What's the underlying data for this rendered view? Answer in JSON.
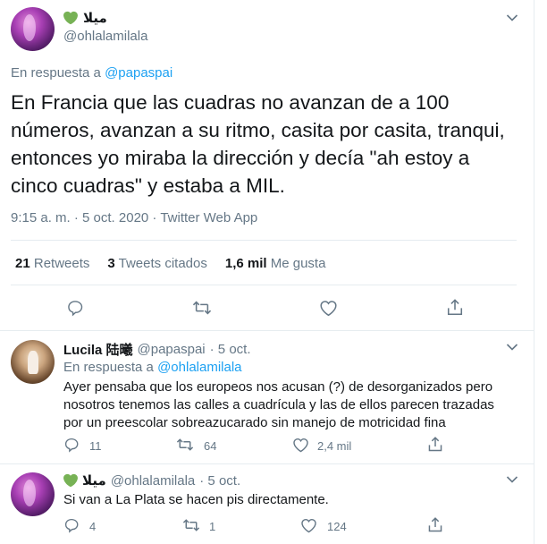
{
  "main_tweet": {
    "author_name": "ميلا",
    "author_handle": "@ohlalamilala",
    "reply_prefix": "En respuesta a",
    "reply_to": "@papaspai",
    "text": "En Francia que las cuadras no avanzan de a 100 números, avanzan a su ritmo, casita por casita, tranqui, entonces yo miraba la dirección y decía \"ah estoy a cinco cuadras\" y estaba a MIL.",
    "meta": "9:15 a. m. · 5 oct. 2020 · Twitter Web App",
    "stats": {
      "retweets_count": "21",
      "retweets_label": "Retweets",
      "quotes_count": "3",
      "quotes_label": "Tweets citados",
      "likes_count": "1,6 mil",
      "likes_label": "Me gusta"
    }
  },
  "replies": [
    {
      "author_name": "Lucila 陆曦",
      "author_handle": "@papaspai",
      "date": "· 5 oct.",
      "reply_prefix": "En respuesta a",
      "reply_to": "@ohlalamilala",
      "text": "Ayer pensaba que los europeos nos acusan (?) de desorganizados pero nosotros tenemos las calles a cuadrícula y las de ellos parecen trazadas por un preescolar sobreazucarado sin manejo de motricidad fina",
      "reply_count": "11",
      "retweet_count": "64",
      "like_count": "2,4 mil"
    },
    {
      "author_name": "ميلا",
      "author_handle": "@ohlalamilala",
      "date": "· 5 oct.",
      "text": "Si van a La Plata se hacen pis directamente.",
      "reply_count": "4",
      "retweet_count": "1",
      "like_count": "124"
    }
  ],
  "colors": {
    "accent": "#1da1f2",
    "muted": "#657786",
    "heart_emoji": "#77b255",
    "border": "#e6ecf0"
  },
  "icons": [
    "green-heart-icon",
    "chevron-down-icon",
    "reply-icon",
    "retweet-icon",
    "like-icon",
    "share-icon"
  ]
}
